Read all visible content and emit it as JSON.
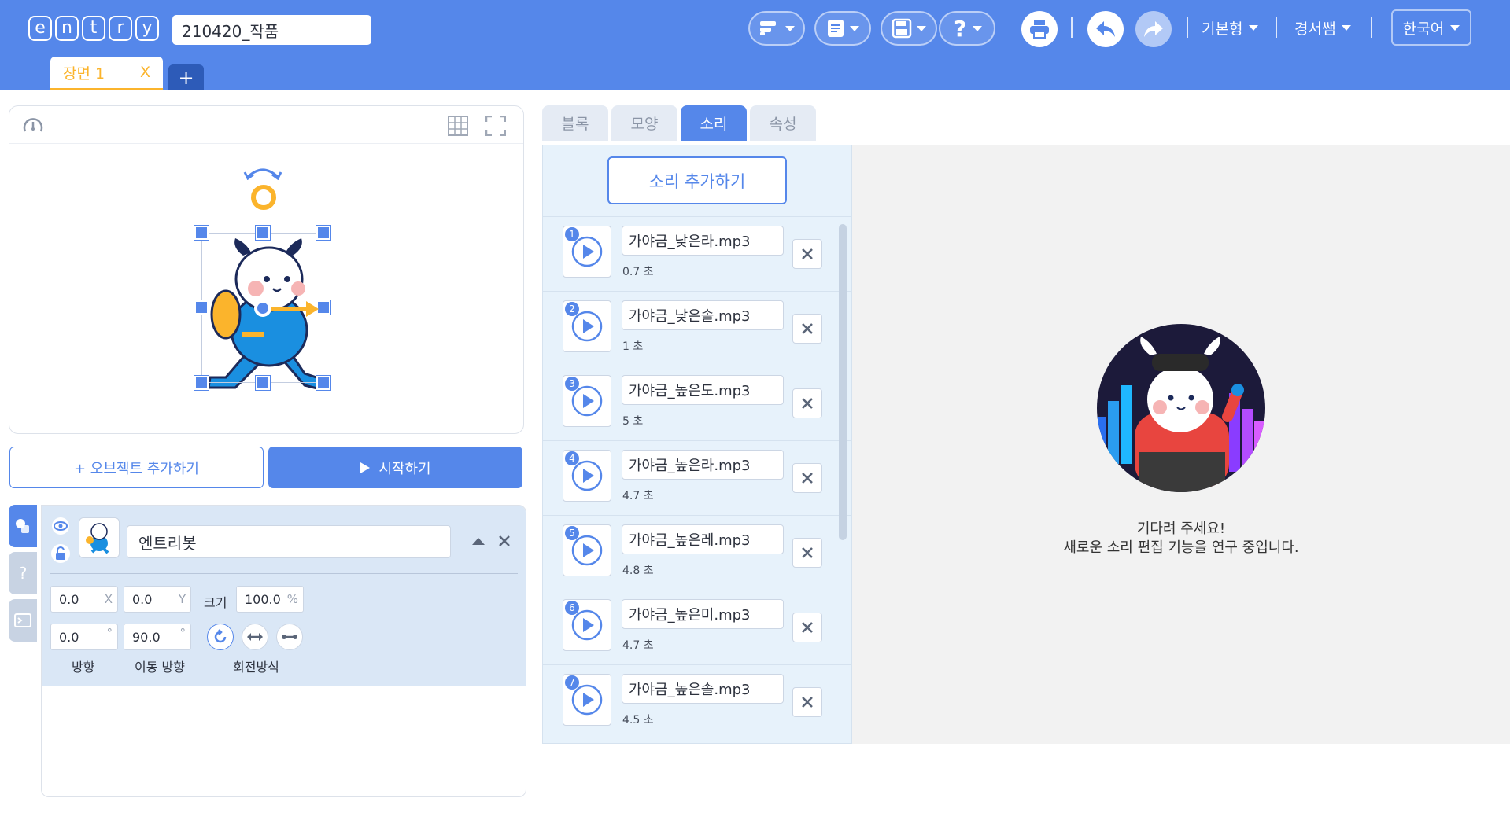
{
  "app": {
    "logo_letters": [
      "e",
      "n",
      "t",
      "r",
      "y"
    ],
    "project_title": "210420_작품"
  },
  "toolbar": {
    "menus": [
      {
        "icon": "blocks-menu-icon"
      },
      {
        "icon": "document-menu-icon"
      },
      {
        "icon": "save-menu-icon"
      },
      {
        "icon": "help-menu-icon"
      }
    ],
    "mode_label": "기본형",
    "user_label": "경서쌤",
    "language_label": "한국어"
  },
  "scene": {
    "tab_label": "장면 1",
    "tab_close": "X",
    "add_label": "+"
  },
  "stage": {
    "add_object_label": "+ 오브젝트 추가하기",
    "start_label": "시작하기"
  },
  "object": {
    "name": "엔트리봇",
    "x": "0.0",
    "x_unit": "X",
    "y": "0.0",
    "y_unit": "Y",
    "size_label": "크기",
    "size": "100.0",
    "size_unit": "%",
    "direction": "0.0",
    "direction_unit": "°",
    "move_direction": "90.0",
    "move_direction_unit": "°",
    "direction_label": "방향",
    "move_direction_label": "이동 방향",
    "rotation_label": "회전방식"
  },
  "side_tabs": {
    "help_label": "?"
  },
  "tabs": [
    "블록",
    "모양",
    "소리",
    "속성"
  ],
  "active_tab": "소리",
  "sound": {
    "add_label": "소리 추가하기",
    "items": [
      {
        "num": "1",
        "name": "가야금_낮은라.mp3",
        "duration": "0.7 초"
      },
      {
        "num": "2",
        "name": "가야금_낮은솔.mp3",
        "duration": "1 초"
      },
      {
        "num": "3",
        "name": "가야금_높은도.mp3",
        "duration": "5 초"
      },
      {
        "num": "4",
        "name": "가야금_높은라.mp3",
        "duration": "4.7 초"
      },
      {
        "num": "5",
        "name": "가야금_높은레.mp3",
        "duration": "4.8 초"
      },
      {
        "num": "6",
        "name": "가야금_높은미.mp3",
        "duration": "4.7 초"
      },
      {
        "num": "7",
        "name": "가야금_높은솔.mp3",
        "duration": "4.5 초"
      }
    ]
  },
  "editor": {
    "wait_line1": "기다려 주세요!",
    "wait_line2": "새로운 소리 편집 기능을 연구 중입니다."
  },
  "colors": {
    "brand": "#5587ea",
    "scene_tab": "#fbb42c",
    "sound_panel": "#e7f2fb"
  }
}
